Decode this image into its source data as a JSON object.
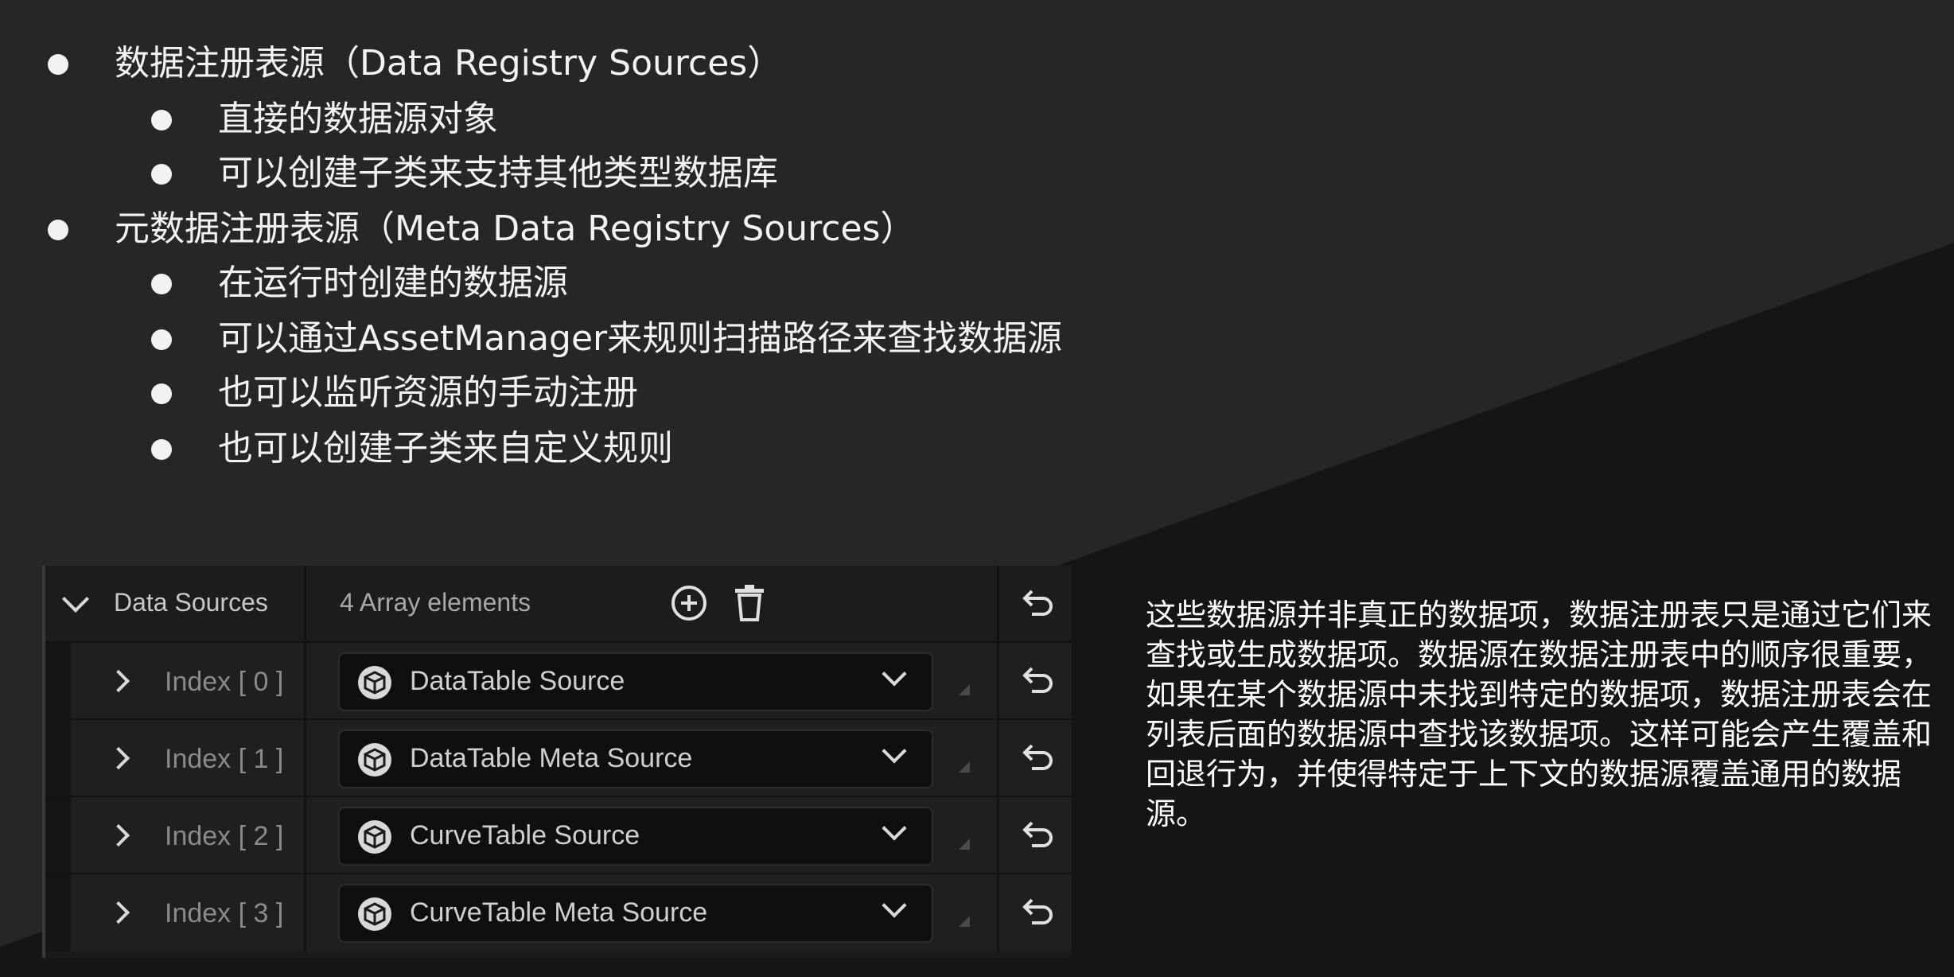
{
  "bullets": [
    {
      "level": 1,
      "text": "数据注册表源（Data Registry Sources）"
    },
    {
      "level": 2,
      "text": "直接的数据源对象"
    },
    {
      "level": 2,
      "text": "可以创建子类来支持其他类型数据库"
    },
    {
      "level": 1,
      "text": "元数据注册表源（Meta Data Registry Sources）"
    },
    {
      "level": 2,
      "text": "在运行时创建的数据源"
    },
    {
      "level": 2,
      "text": "可以通过AssetManager来规则扫描路径来查找数据源"
    },
    {
      "level": 2,
      "text": "也可以监听资源的手动注册"
    },
    {
      "level": 2,
      "text": "也可以创建子类来自定义规则"
    }
  ],
  "panel": {
    "header_label": "Data Sources",
    "header_count": "4 Array elements",
    "rows": [
      {
        "index": "Index [ 0 ]",
        "value": "DataTable Source"
      },
      {
        "index": "Index [ 1 ]",
        "value": "DataTable Meta Source"
      },
      {
        "index": "Index [ 2 ]",
        "value": "CurveTable Source"
      },
      {
        "index": "Index [ 3 ]",
        "value": "CurveTable Meta Source"
      }
    ],
    "icons": {
      "expand": "chevron-down-icon",
      "collapse": "chevron-right-icon",
      "add": "add-circle-icon",
      "delete": "trash-icon",
      "reset": "reset-arrow-icon",
      "asset": "cube-icon"
    }
  },
  "description": "这些数据源并非真正的数据项，数据注册表只是通过它们来查找或生成数据项。数据源在数据注册表中的顺序很重要，如果在某个数据源中未找到特定的数据项，数据注册表会在列表后面的数据源中查找该数据项。这样可能会产生覆盖和回退行为，并使得特定于上下文的数据源覆盖通用的数据源。",
  "colors": {
    "background": "#262626",
    "wedge": "#151515",
    "panel": "#1a1a1a",
    "text": "#ffffff"
  }
}
